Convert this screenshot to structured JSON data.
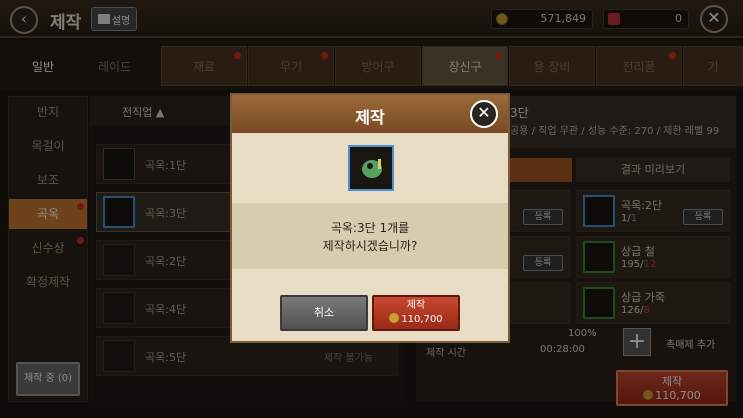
{
  "header": {
    "title": "제작",
    "guide_label": "설명",
    "gold": "571,849",
    "gems": "0"
  },
  "modes": [
    "일반",
    "레이드"
  ],
  "categories": [
    {
      "label": "재료",
      "dot": true
    },
    {
      "label": "무기",
      "dot": true
    },
    {
      "label": "방어구",
      "dot": false
    },
    {
      "label": "장신구",
      "dot": true
    },
    {
      "label": "용 장비",
      "dot": false
    },
    {
      "label": "전리품",
      "dot": true
    },
    {
      "label": "기",
      "dot": false
    }
  ],
  "sidebar": {
    "items": [
      {
        "label": "반지"
      },
      {
        "label": "목걸이"
      },
      {
        "label": "보조"
      },
      {
        "label": "곡옥"
      },
      {
        "label": "신수상"
      },
      {
        "label": "확정제작"
      }
    ],
    "crafting_count": "제작 중 (0)"
  },
  "list": {
    "sort_label": "전직업 ▲",
    "rows": [
      {
        "label": "곡옥:1단",
        "status": ""
      },
      {
        "label": "곡옥:3단",
        "status": ""
      },
      {
        "label": "곡옥:2단",
        "status": ""
      },
      {
        "label": "곡옥:4단",
        "status": ""
      },
      {
        "label": "곡옥:5단",
        "status": "제작 불가능"
      }
    ]
  },
  "detail": {
    "title": "3단",
    "subtitle": "공용 / 직업 무관 / 성능 수준: 270 / 제한 레벨 99",
    "tab_preview": "결과 미리보기",
    "materials": [
      {
        "name": "곡옥:2단",
        "have": "1",
        "need": "1",
        "register": "등록"
      },
      {
        "name": "상급 철",
        "have": "195",
        "need": "12"
      },
      {
        "name": "상급 가죽",
        "have": "126",
        "need": "8"
      }
    ],
    "left_register": [
      "등록",
      "등록"
    ],
    "success_rate": "100%",
    "craft_time_label": "제작 시간",
    "craft_time": "00:28:00",
    "catalyst_label": "촉매제 추가",
    "craft_label": "제작",
    "craft_cost": "110,700"
  },
  "modal": {
    "title": "제작",
    "line1": "곡옥:3단 1개를",
    "line2": "제작하시겠습니까?",
    "cancel": "취소",
    "confirm": "제작",
    "cost": "110,700"
  },
  "colors": {
    "accent": "#c87830",
    "craft_red": "#c84830"
  }
}
